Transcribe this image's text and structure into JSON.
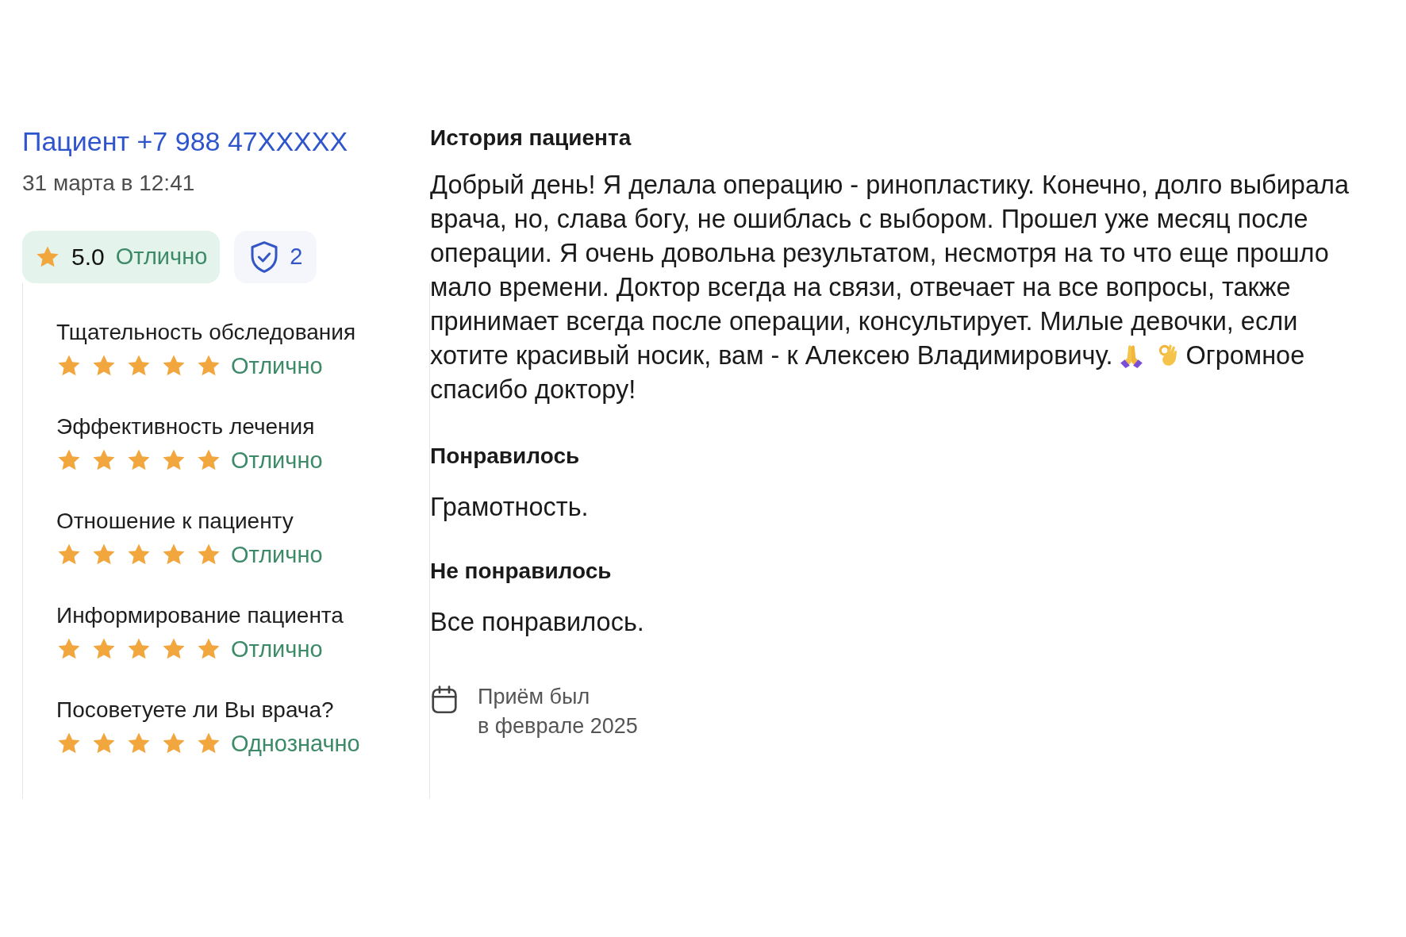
{
  "author": {
    "name": "Пациент +7 988 47XXXXX",
    "date": "31 марта в 12:41"
  },
  "rating": {
    "score": "5.0",
    "verdict": "Отлично"
  },
  "verified": {
    "count": "2"
  },
  "criteria": [
    {
      "label": "Тщательность обследования",
      "stars": 5,
      "verdict": "Отлично"
    },
    {
      "label": "Эффективность лечения",
      "stars": 5,
      "verdict": "Отлично"
    },
    {
      "label": "Отношение к пациенту",
      "stars": 5,
      "verdict": "Отлично"
    },
    {
      "label": "Информирование пациента",
      "stars": 5,
      "verdict": "Отлично"
    },
    {
      "label": "Посоветуете ли Вы врача?",
      "stars": 5,
      "verdict": "Однозначно"
    }
  ],
  "story": {
    "heading": "История пациента",
    "text_before": "Добрый день! Я делала операцию - ринопластику. Конечно, долго выбирала врача, но, слава богу, не ошиблась с выбором. Прошел уже месяц после операции. Я очень довольна результатом, несмотря на то что еще прошло мало времени. Доктор всегда на связи, отвечает на все вопросы, также принимает всегда после операции, консультирует. Милые девочки, если хотите красивый носик, вам - к Алексею Владимировичу.",
    "text_after": "Огромное спасибо доктору!"
  },
  "liked": {
    "heading": "Понравилось",
    "text": "Грамотность."
  },
  "disliked": {
    "heading": "Не понравилось",
    "text": "Все понравилось."
  },
  "visit": {
    "lines": [
      "Приём был",
      "в феврале 2025"
    ]
  }
}
